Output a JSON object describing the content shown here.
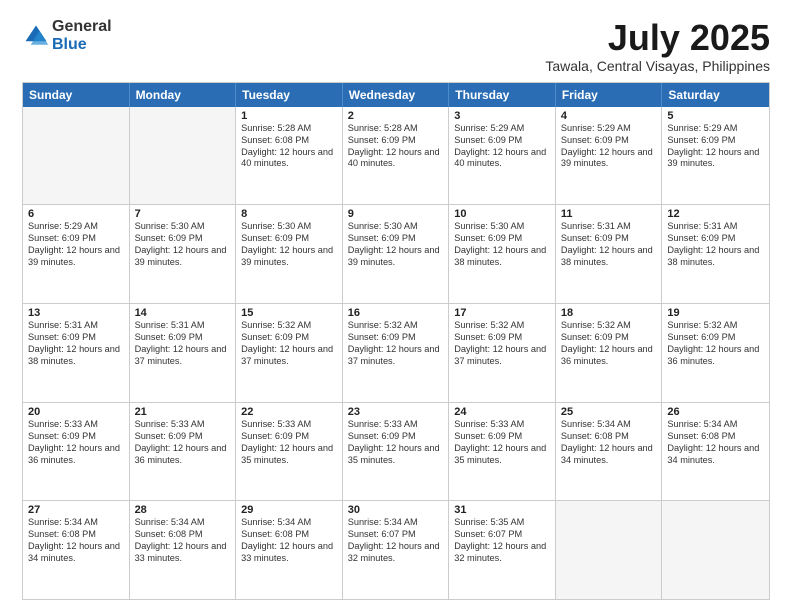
{
  "logo": {
    "general": "General",
    "blue": "Blue"
  },
  "header": {
    "month": "July 2025",
    "location": "Tawala, Central Visayas, Philippines"
  },
  "days_of_week": [
    "Sunday",
    "Monday",
    "Tuesday",
    "Wednesday",
    "Thursday",
    "Friday",
    "Saturday"
  ],
  "weeks": [
    [
      {
        "day": "",
        "sunrise": "",
        "sunset": "",
        "daylight": "",
        "empty": true
      },
      {
        "day": "",
        "sunrise": "",
        "sunset": "",
        "daylight": "",
        "empty": true
      },
      {
        "day": "1",
        "sunrise": "Sunrise: 5:28 AM",
        "sunset": "Sunset: 6:08 PM",
        "daylight": "Daylight: 12 hours and 40 minutes."
      },
      {
        "day": "2",
        "sunrise": "Sunrise: 5:28 AM",
        "sunset": "Sunset: 6:09 PM",
        "daylight": "Daylight: 12 hours and 40 minutes."
      },
      {
        "day": "3",
        "sunrise": "Sunrise: 5:29 AM",
        "sunset": "Sunset: 6:09 PM",
        "daylight": "Daylight: 12 hours and 40 minutes."
      },
      {
        "day": "4",
        "sunrise": "Sunrise: 5:29 AM",
        "sunset": "Sunset: 6:09 PM",
        "daylight": "Daylight: 12 hours and 39 minutes."
      },
      {
        "day": "5",
        "sunrise": "Sunrise: 5:29 AM",
        "sunset": "Sunset: 6:09 PM",
        "daylight": "Daylight: 12 hours and 39 minutes."
      }
    ],
    [
      {
        "day": "6",
        "sunrise": "Sunrise: 5:29 AM",
        "sunset": "Sunset: 6:09 PM",
        "daylight": "Daylight: 12 hours and 39 minutes."
      },
      {
        "day": "7",
        "sunrise": "Sunrise: 5:30 AM",
        "sunset": "Sunset: 6:09 PM",
        "daylight": "Daylight: 12 hours and 39 minutes."
      },
      {
        "day": "8",
        "sunrise": "Sunrise: 5:30 AM",
        "sunset": "Sunset: 6:09 PM",
        "daylight": "Daylight: 12 hours and 39 minutes."
      },
      {
        "day": "9",
        "sunrise": "Sunrise: 5:30 AM",
        "sunset": "Sunset: 6:09 PM",
        "daylight": "Daylight: 12 hours and 39 minutes."
      },
      {
        "day": "10",
        "sunrise": "Sunrise: 5:30 AM",
        "sunset": "Sunset: 6:09 PM",
        "daylight": "Daylight: 12 hours and 38 minutes."
      },
      {
        "day": "11",
        "sunrise": "Sunrise: 5:31 AM",
        "sunset": "Sunset: 6:09 PM",
        "daylight": "Daylight: 12 hours and 38 minutes."
      },
      {
        "day": "12",
        "sunrise": "Sunrise: 5:31 AM",
        "sunset": "Sunset: 6:09 PM",
        "daylight": "Daylight: 12 hours and 38 minutes."
      }
    ],
    [
      {
        "day": "13",
        "sunrise": "Sunrise: 5:31 AM",
        "sunset": "Sunset: 6:09 PM",
        "daylight": "Daylight: 12 hours and 38 minutes."
      },
      {
        "day": "14",
        "sunrise": "Sunrise: 5:31 AM",
        "sunset": "Sunset: 6:09 PM",
        "daylight": "Daylight: 12 hours and 37 minutes."
      },
      {
        "day": "15",
        "sunrise": "Sunrise: 5:32 AM",
        "sunset": "Sunset: 6:09 PM",
        "daylight": "Daylight: 12 hours and 37 minutes."
      },
      {
        "day": "16",
        "sunrise": "Sunrise: 5:32 AM",
        "sunset": "Sunset: 6:09 PM",
        "daylight": "Daylight: 12 hours and 37 minutes."
      },
      {
        "day": "17",
        "sunrise": "Sunrise: 5:32 AM",
        "sunset": "Sunset: 6:09 PM",
        "daylight": "Daylight: 12 hours and 37 minutes."
      },
      {
        "day": "18",
        "sunrise": "Sunrise: 5:32 AM",
        "sunset": "Sunset: 6:09 PM",
        "daylight": "Daylight: 12 hours and 36 minutes."
      },
      {
        "day": "19",
        "sunrise": "Sunrise: 5:32 AM",
        "sunset": "Sunset: 6:09 PM",
        "daylight": "Daylight: 12 hours and 36 minutes."
      }
    ],
    [
      {
        "day": "20",
        "sunrise": "Sunrise: 5:33 AM",
        "sunset": "Sunset: 6:09 PM",
        "daylight": "Daylight: 12 hours and 36 minutes."
      },
      {
        "day": "21",
        "sunrise": "Sunrise: 5:33 AM",
        "sunset": "Sunset: 6:09 PM",
        "daylight": "Daylight: 12 hours and 36 minutes."
      },
      {
        "day": "22",
        "sunrise": "Sunrise: 5:33 AM",
        "sunset": "Sunset: 6:09 PM",
        "daylight": "Daylight: 12 hours and 35 minutes."
      },
      {
        "day": "23",
        "sunrise": "Sunrise: 5:33 AM",
        "sunset": "Sunset: 6:09 PM",
        "daylight": "Daylight: 12 hours and 35 minutes."
      },
      {
        "day": "24",
        "sunrise": "Sunrise: 5:33 AM",
        "sunset": "Sunset: 6:09 PM",
        "daylight": "Daylight: 12 hours and 35 minutes."
      },
      {
        "day": "25",
        "sunrise": "Sunrise: 5:34 AM",
        "sunset": "Sunset: 6:08 PM",
        "daylight": "Daylight: 12 hours and 34 minutes."
      },
      {
        "day": "26",
        "sunrise": "Sunrise: 5:34 AM",
        "sunset": "Sunset: 6:08 PM",
        "daylight": "Daylight: 12 hours and 34 minutes."
      }
    ],
    [
      {
        "day": "27",
        "sunrise": "Sunrise: 5:34 AM",
        "sunset": "Sunset: 6:08 PM",
        "daylight": "Daylight: 12 hours and 34 minutes."
      },
      {
        "day": "28",
        "sunrise": "Sunrise: 5:34 AM",
        "sunset": "Sunset: 6:08 PM",
        "daylight": "Daylight: 12 hours and 33 minutes."
      },
      {
        "day": "29",
        "sunrise": "Sunrise: 5:34 AM",
        "sunset": "Sunset: 6:08 PM",
        "daylight": "Daylight: 12 hours and 33 minutes."
      },
      {
        "day": "30",
        "sunrise": "Sunrise: 5:34 AM",
        "sunset": "Sunset: 6:07 PM",
        "daylight": "Daylight: 12 hours and 32 minutes."
      },
      {
        "day": "31",
        "sunrise": "Sunrise: 5:35 AM",
        "sunset": "Sunset: 6:07 PM",
        "daylight": "Daylight: 12 hours and 32 minutes."
      },
      {
        "day": "",
        "sunrise": "",
        "sunset": "",
        "daylight": "",
        "empty": true
      },
      {
        "day": "",
        "sunrise": "",
        "sunset": "",
        "daylight": "",
        "empty": true
      }
    ]
  ]
}
